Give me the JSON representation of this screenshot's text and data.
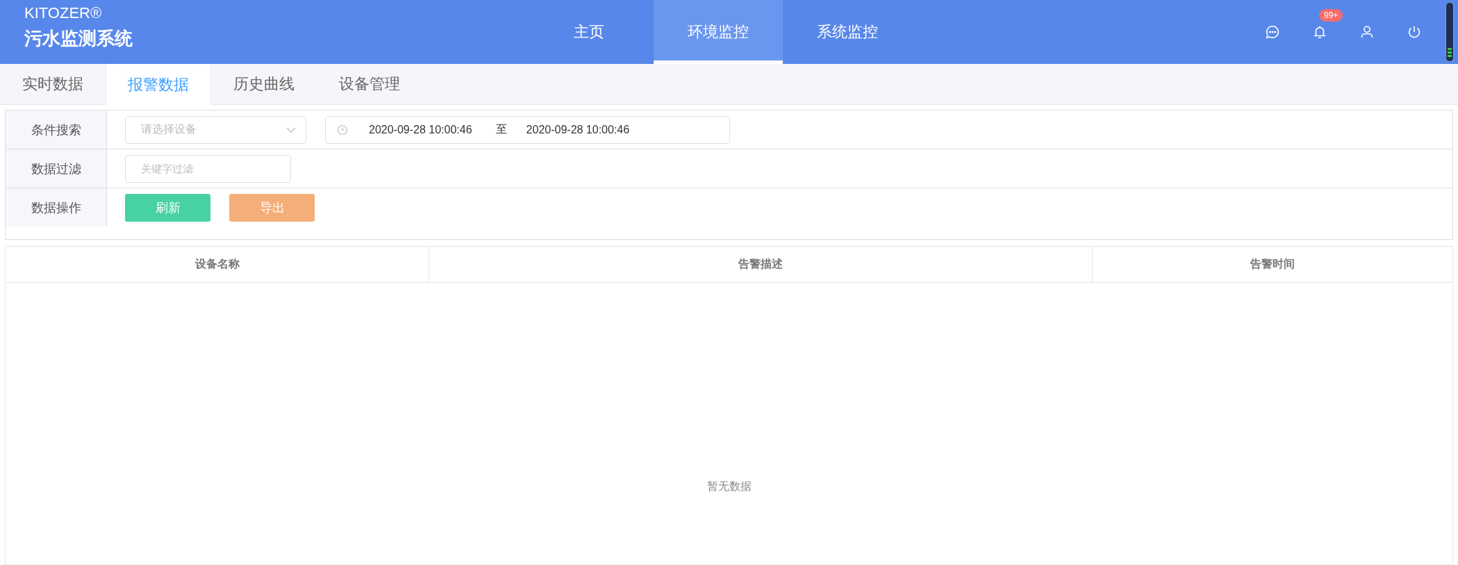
{
  "header": {
    "brand": "KITOZER®",
    "title": "污水监测系统",
    "nav": [
      {
        "label": "主页",
        "selected": false
      },
      {
        "label": "环境监控",
        "selected": true
      },
      {
        "label": "系统监控",
        "selected": false
      }
    ],
    "notification_badge": "99+"
  },
  "tabs": [
    {
      "label": "实时数据",
      "selected": false
    },
    {
      "label": "报警数据",
      "selected": true
    },
    {
      "label": "历史曲线",
      "selected": false
    },
    {
      "label": "设备管理",
      "selected": false
    }
  ],
  "filters": {
    "search_label": "条件搜索",
    "device_select": {
      "placeholder": "请选择设备"
    },
    "date_start": "2020-09-28 10:00:46",
    "date_separator": "至",
    "date_end": "2020-09-28 10:00:46",
    "filter_label": "数据过滤",
    "keyword": {
      "placeholder": "关键字过滤"
    },
    "action_label": "数据操作",
    "buttons": [
      {
        "label": "刷新",
        "kind": "refresh"
      },
      {
        "label": "导出",
        "kind": "export"
      }
    ]
  },
  "table": {
    "columns": [
      "设备名称",
      "告警描述",
      "告警时间"
    ],
    "empty_text": "暂无数据"
  }
}
